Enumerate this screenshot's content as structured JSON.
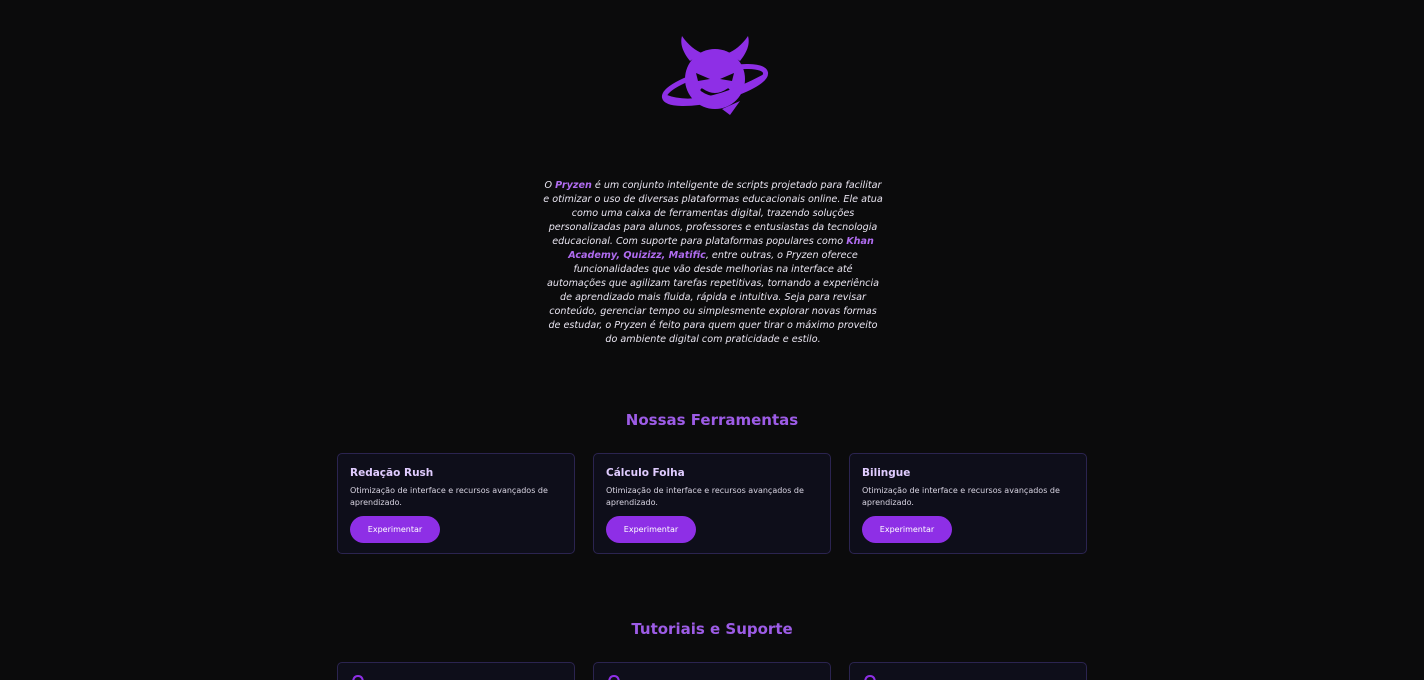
{
  "brand": {
    "name": "Pryzen",
    "logo_icon": "devil-planet-logo-icon",
    "accent_color": "#8e2fe6"
  },
  "intro": {
    "part1": "O ",
    "brand": "Pryzen",
    "part2": " é um conjunto inteligente de scripts projetado para facilitar e otimizar o uso de diversas plataformas educacionais online. Ele atua como uma caixa de ferramentas digital, trazendo soluções personalizadas para alunos, professores e entusiastas da tecnologia educacional. Com suporte para plataformas populares como ",
    "platforms": "Khan Academy, Quizizz, Matific",
    "part3": ", entre outras, o Pryzen oferece funcionalidades que vão desde melhorias na interface até automações que agilizam tarefas repetitivas, tornando a experiência de aprendizado mais fluida, rápida e intuitiva. Seja para revisar conteúdo, gerenciar tempo ou simplesmente explorar novas formas de estudar, o Pryzen é feito para quem quer tirar o máximo proveito do ambiente digital com praticidade e estilo."
  },
  "tools": {
    "title": "Nossas Ferramentas",
    "cards": [
      {
        "title": "Redação Rush",
        "description": "Otimização de interface e recursos avançados de aprendizado.",
        "button": "Experimentar"
      },
      {
        "title": "Cálculo Folha",
        "description": "Otimização de interface e recursos avançados de aprendizado.",
        "button": "Experimentar"
      },
      {
        "title": "Bilingue",
        "description": "Otimização de interface e recursos avançados de aprendizado.",
        "button": "Experimentar"
      }
    ]
  },
  "tutorials": {
    "title": "Tutoriais e Suporte",
    "card_icon": "support-icon"
  }
}
